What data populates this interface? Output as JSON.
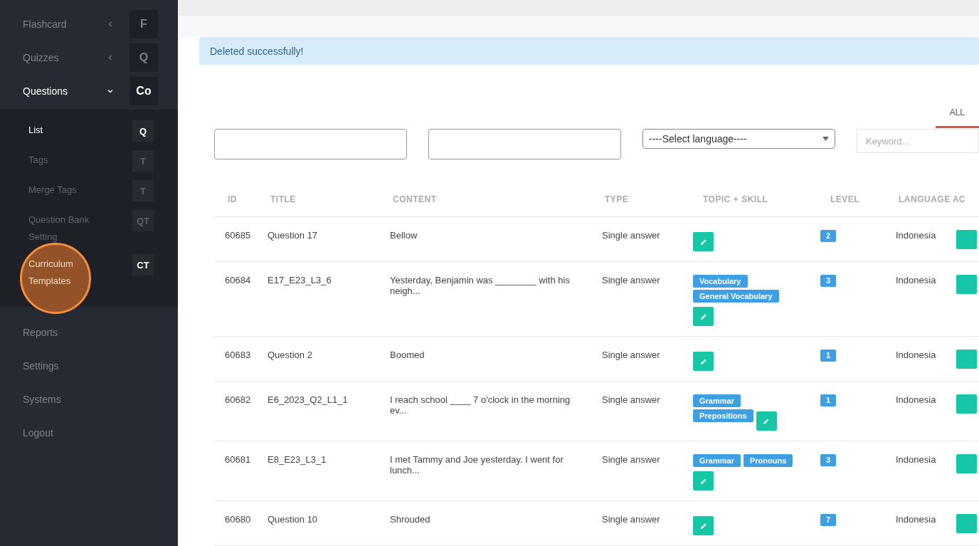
{
  "sidebar": {
    "items": [
      {
        "label": "Flashcard",
        "badge": "F",
        "expanded": false,
        "selected": false
      },
      {
        "label": "Quizzes",
        "badge": "Q",
        "expanded": false,
        "selected": false
      },
      {
        "label": "Questions",
        "badge": "Co",
        "expanded": true,
        "selected": true,
        "children": [
          {
            "label": "List",
            "badge": "Q",
            "selected": true
          },
          {
            "label": "Tags",
            "badge": "T",
            "selected": false
          },
          {
            "label": "Merge Tags",
            "badge": "T",
            "selected": false
          },
          {
            "label": "Question Bank Setting",
            "badge": "QT",
            "selected": false
          },
          {
            "label": "Curriculum Templates",
            "badge": "CT",
            "selected": false,
            "highlighted": true
          }
        ]
      },
      {
        "label": "Reports",
        "selected": false
      },
      {
        "label": "Settings",
        "selected": false
      },
      {
        "label": "Systems",
        "selected": false
      },
      {
        "label": "Logout",
        "selected": false
      }
    ]
  },
  "alert": "Deleted successfully!",
  "tabs": [
    {
      "label": "ALL",
      "selected": true
    }
  ],
  "filters": {
    "select": "----Select language----",
    "keyword_placeholder": "Keyword..."
  },
  "table": {
    "columns": [
      "ID",
      "TITLE",
      "CONTENT",
      "TYPE",
      "TOPIC + SKILL",
      "LEVEL",
      "LANGUAGE",
      "AC"
    ],
    "rows": [
      {
        "id": "60685",
        "title": "Question 17",
        "content": "Bellow",
        "type": "Single answer",
        "tags": [],
        "level_badge": "2",
        "language": "Indonesia"
      },
      {
        "id": "60684",
        "title": "E17_E23_L3_6",
        "content": "Yesterday, Benjamin was ________ with his neigh...",
        "type": "Single answer",
        "tags": [
          "Vocabulary",
          "General Vocabulary"
        ],
        "level_badge": "3",
        "language": "Indonesia"
      },
      {
        "id": "60683",
        "title": "Question 2",
        "content": "Boomed",
        "type": "Single answer",
        "tags": [],
        "level_badge": "1",
        "language": "Indonesia"
      },
      {
        "id": "60682",
        "title": "E6_2023_Q2_L1_1",
        "content": "I reach school ____ 7 o'clock in the morning ev...",
        "type": "Single answer",
        "tags": [
          "Grammar",
          "Prepositions"
        ],
        "level_badge": "1",
        "language": "Indonesia"
      },
      {
        "id": "60681",
        "title": "E8_E23_L3_1",
        "content": "I met Tammy and Joe yesterday. I went for lunch...",
        "type": "Single answer",
        "tags": [
          "Grammar",
          "Pronouns"
        ],
        "level_badge": "3",
        "language": "Indonesia"
      },
      {
        "id": "60680",
        "title": "Question 10",
        "content": "Shrouded",
        "type": "Single answer",
        "tags": [],
        "level_badge": "7",
        "language": "Indonesia"
      }
    ]
  }
}
